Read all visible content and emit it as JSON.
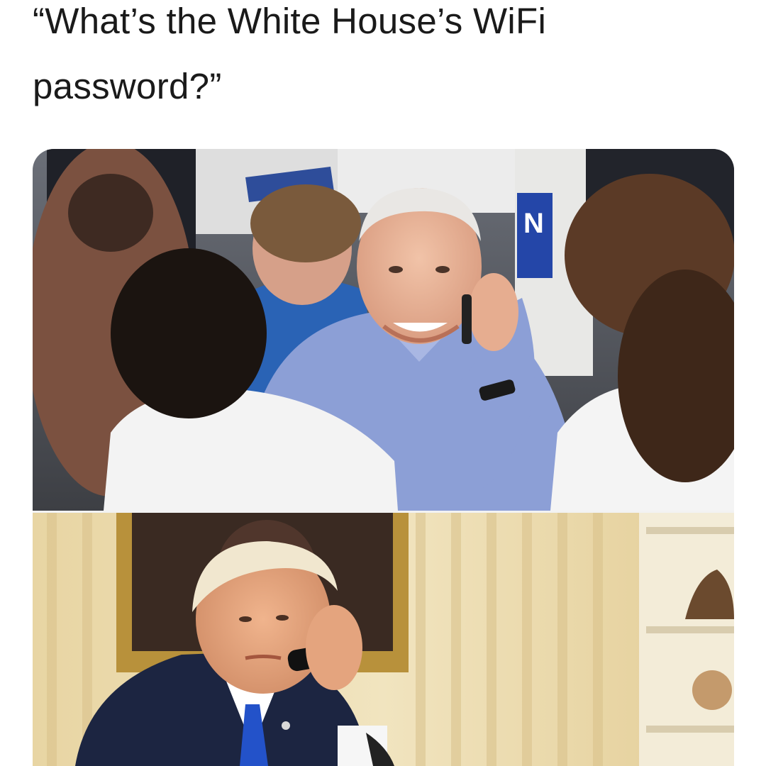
{
  "meme": {
    "caption_line1": "“What’s the White House’s WiFi",
    "caption_line2": "password?”"
  },
  "photos": {
    "top": {
      "sign_text": "N"
    },
    "bottom": {}
  },
  "colors": {
    "caption_text": "#1a1a1a",
    "background": "#ffffff",
    "shirt_blue": "#8c9fd6",
    "suit_navy": "#1c2541",
    "tie_blue": "#2352c9",
    "wall_cream": "#ead8a8"
  }
}
